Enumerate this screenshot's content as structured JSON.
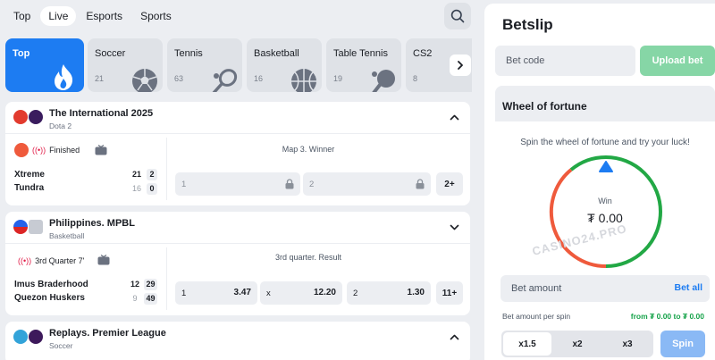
{
  "nav": {
    "tabs": [
      {
        "label": "Top"
      },
      {
        "label": "Live"
      },
      {
        "label": "Esports"
      },
      {
        "label": "Sports"
      }
    ],
    "active": "Live"
  },
  "sports": [
    {
      "name": "Top",
      "count": "",
      "icon": "flame-icon"
    },
    {
      "name": "Soccer",
      "count": "21",
      "icon": "soccer-ball-icon"
    },
    {
      "name": "Tennis",
      "count": "63",
      "icon": "tennis-racket-icon"
    },
    {
      "name": "Basketball",
      "count": "16",
      "icon": "basketball-icon"
    },
    {
      "name": "Table Tennis",
      "count": "19",
      "icon": "table-tennis-icon"
    },
    {
      "name": "CS2",
      "count": "8",
      "icon": "cs2-icon"
    }
  ],
  "matches": [
    {
      "title": "The International 2025",
      "subtitle": "Dota 2",
      "status": "Finished",
      "team1": "Xtreme",
      "team2": "Tundra",
      "team1_scores": [
        "21",
        "2"
      ],
      "team2_scores": [
        "16",
        "0"
      ],
      "market": "Map 3. Winner",
      "odds": [
        {
          "label": "1"
        },
        {
          "label": "2"
        }
      ],
      "more": "2+"
    },
    {
      "title": "Philippines. MPBL",
      "subtitle": "Basketball",
      "status": "3rd Quarter 7'",
      "team1": "Imus Braderhood",
      "team2": "Quezon Huskers",
      "team1_scores": [
        "12",
        "29"
      ],
      "team2_scores": [
        "9",
        "49"
      ],
      "market": "3rd quarter. Result",
      "odds": [
        {
          "label": "1",
          "value": "3.47"
        },
        {
          "label": "x",
          "value": "12.20"
        },
        {
          "label": "2",
          "value": "1.30"
        }
      ],
      "more": "11+"
    },
    {
      "title": "Replays. Premier League",
      "subtitle": "Soccer"
    }
  ],
  "betslip": {
    "title": "Betslip",
    "code_placeholder": "Bet code",
    "upload_label": "Upload bet",
    "wheel": {
      "title": "Wheel of fortune",
      "description": "Spin the wheel of fortune and try your luck!",
      "win_label": "Win",
      "win_value": "₮ 0.00",
      "watermark": "CASINO24.PRO"
    },
    "amount_placeholder": "Bet amount",
    "bet_all": "Bet all",
    "per_spin_label": "Bet amount per spin",
    "per_spin_range": "from ₮ 0.00 to ₮ 0.00",
    "multipliers": [
      "x1.5",
      "x2",
      "x3"
    ],
    "spin_label": "Spin"
  },
  "colors": {
    "accent": "#1d7cf2",
    "win_green": "#22a845",
    "wheel_red": "#ef5a3c",
    "upload_green": "#86d6a6"
  }
}
